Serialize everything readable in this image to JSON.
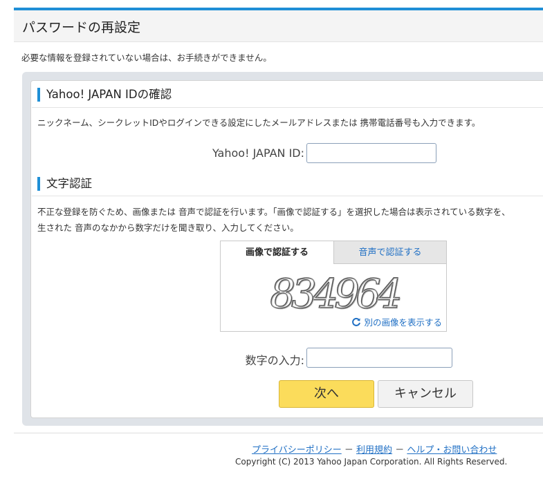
{
  "header": {
    "title": "パスワードの再設定"
  },
  "intro": "必要な情報を登録されていない場合は、お手続きができません。",
  "id_section": {
    "title": "Yahoo! JAPAN IDの確認",
    "description": "ニックネーム、シークレットIDやログインできる設定にしたメールアドレスまたは 携帯電話番号も入力できます。",
    "field_label": "Yahoo! JAPAN ID:",
    "field_value": ""
  },
  "captcha_section": {
    "title": "文字認証",
    "description_line1": "不正な登録を防ぐため、画像または 音声で認証を行います。「画像で認証する」を選択した場合は表示されている数字を、",
    "description_line2": "生された 音声のなかから数字だけを聞き取り、入力してください。",
    "tabs": [
      {
        "label": "画像で認証する",
        "active": true
      },
      {
        "label": "音声で認証する",
        "active": false
      }
    ],
    "captcha_text": "834964",
    "refresh_label": "別の画像を表示する",
    "field_label": "数字の入力:",
    "field_value": ""
  },
  "buttons": {
    "next_label": "次へ",
    "cancel_label": "キャンセル"
  },
  "footer": {
    "links": [
      {
        "label": "プライバシーポリシー"
      },
      {
        "label": "利用規約"
      },
      {
        "label": "ヘルプ・お問い合わせ"
      }
    ],
    "separator": "－",
    "copyright": "Copyright (C) 2013 Yahoo Japan Corporation. All Rights Reserved."
  },
  "colors": {
    "accent": "#1f8fd6",
    "link": "#1f6fc4",
    "next_button": "#fbdc5b"
  },
  "icons": {
    "refresh": "refresh-icon"
  }
}
